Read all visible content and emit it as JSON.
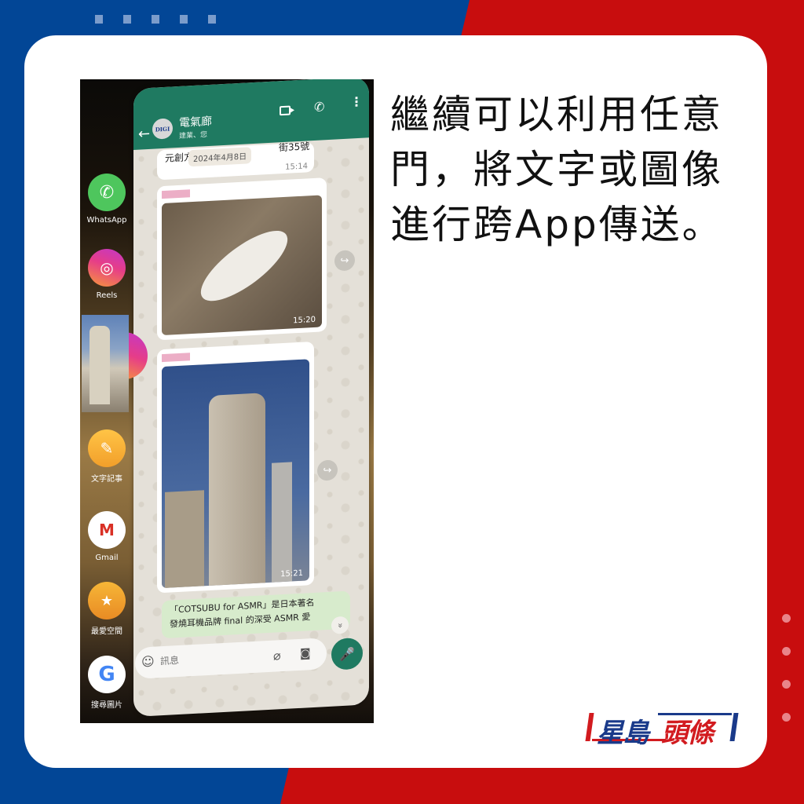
{
  "colors": {
    "brand_blue": "#024696",
    "brand_red": "#c80d0e",
    "whatsapp_green": "#1f7a61"
  },
  "headline": "繼續可以利用任意門，將文字或圖像進行跨App傳送。",
  "logo": {
    "part1": "星島",
    "part2": "頭條"
  },
  "edge_panel": {
    "apps": [
      {
        "label": "WhatsApp",
        "icon": "whatsapp-icon",
        "glyph": "✆"
      },
      {
        "label": "Reels",
        "icon": "instagram-icon",
        "glyph": "◎"
      },
      {
        "label": "文字記事",
        "icon": "pencil-note-icon",
        "glyph": "✎"
      },
      {
        "label": "Gmail",
        "icon": "gmail-icon",
        "glyph": "M"
      },
      {
        "label": "最愛空間",
        "icon": "star-folder-icon",
        "glyph": "★"
      },
      {
        "label": "搜尋圖片",
        "icon": "google-icon",
        "glyph": "G"
      }
    ]
  },
  "chat": {
    "name": "電氣廊",
    "subtitle": "建業、您",
    "avatar_text": "DIGI",
    "header_icons": {
      "video": "video-call-icon",
      "call": "phone-icon",
      "more": "more-options-icon",
      "back": "←",
      "call_glyph": "✆",
      "more_glyph": "⋮"
    },
    "date_chip": "2024年4月8日",
    "messages": [
      {
        "type": "text",
        "text": "元創方 香",
        "text_tail": "街35號",
        "time": "15:14"
      },
      {
        "type": "image",
        "subject": "cat",
        "time": "15:20"
      },
      {
        "type": "image",
        "subject": "building",
        "time": "15:21"
      },
      {
        "type": "text",
        "line1": "「COTSUBU for ASMR」是日本著名",
        "line2": "發燒耳機品牌 final 的深受 ASMR 愛"
      }
    ],
    "forward_glyph": "↪",
    "scroll_down_glyph": "»",
    "input": {
      "placeholder": "訊息",
      "emoji_glyph": "☺",
      "attach_glyph": "⌀",
      "camera_glyph": "◙",
      "mic_glyph": "🎤"
    }
  }
}
